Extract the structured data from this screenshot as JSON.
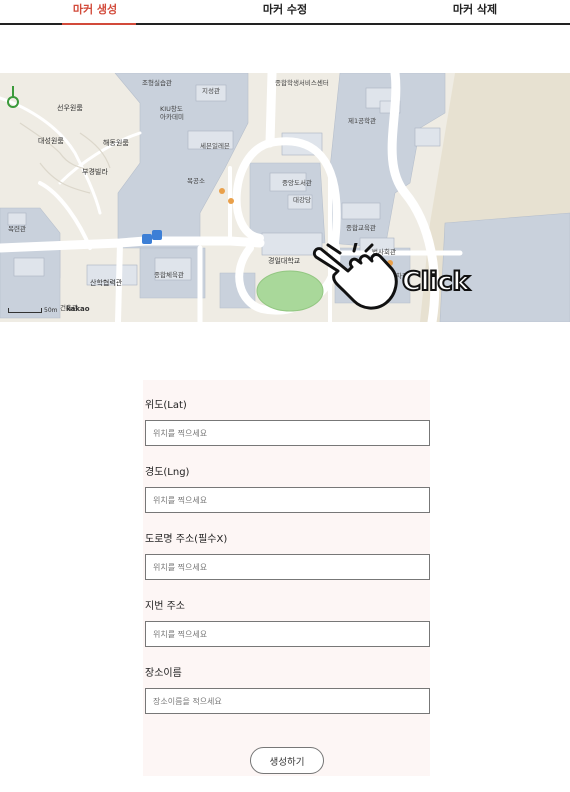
{
  "tabs": [
    {
      "label": "마커 생성",
      "active": true
    },
    {
      "label": "마커 수정",
      "active": false
    },
    {
      "label": "마커 삭제",
      "active": false
    }
  ],
  "map": {
    "labels": {
      "l0": "조형실습관",
      "l1": "지성관",
      "l2": "종합학생서비스센터",
      "l3": "선우원룸",
      "l4": "KIU창도",
      "l5": "아카데미",
      "l6": "제1공학관",
      "l7": "대성원룸",
      "l8": "해동원룸",
      "l9": "세븐일레븐",
      "l10": "부경빌라",
      "l11": "목공소",
      "l12": "중앙도서관",
      "l13": "대강당",
      "l14": "종합교육관",
      "l15": "목련관",
      "l16": "법사회관",
      "l17": "경일대학교",
      "l18": "종합체육관",
      "l19": "산학협력관",
      "l20": "주차장",
      "l21": "건축관"
    },
    "scale_text": "50m",
    "attribution": "kakao",
    "click_text": "Click"
  },
  "form": {
    "lat_label": "위도(Lat)",
    "lat_placeholder": "위치를 찍으세요",
    "lng_label": "경도(Lng)",
    "lng_placeholder": "위치를 찍으세요",
    "road_label": "도로명 주소(필수X)",
    "road_placeholder": "위치를 찍으세요",
    "jibun_label": "지번 주소",
    "jibun_placeholder": "위치를 찍으세요",
    "place_label": "장소이름",
    "place_placeholder": "장소이름을 적으세요",
    "submit_label": "생성하기"
  },
  "colors": {
    "accent": "#d24a3a",
    "form_bg": "#fdf6f5",
    "map_bg": "#efece4",
    "map_building": "#c8d0dc",
    "map_road": "#ffffff",
    "map_green": "#a9d89a"
  }
}
